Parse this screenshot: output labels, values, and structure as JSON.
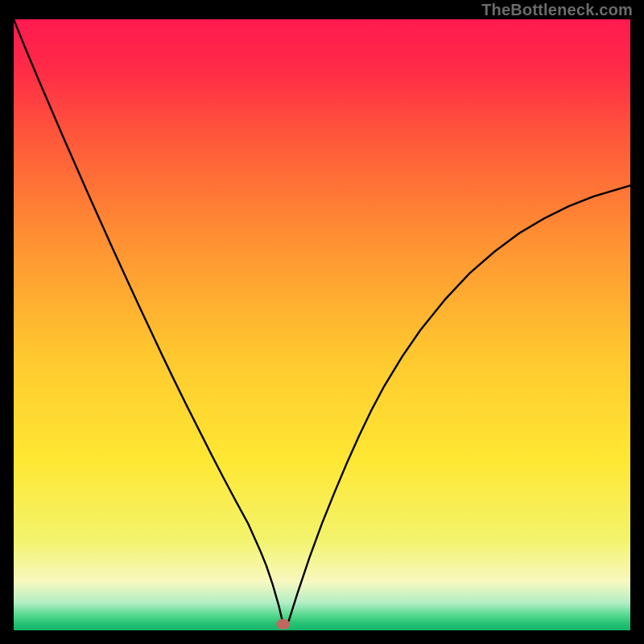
{
  "watermark": "TheBottleneck.com",
  "chart_data": {
    "type": "line",
    "title": "",
    "xlabel": "",
    "ylabel": "",
    "xlim": [
      0,
      100
    ],
    "ylim": [
      0,
      100
    ],
    "background_gradient_stops": [
      {
        "offset": 0.0,
        "color": "#ff1a4f"
      },
      {
        "offset": 0.08,
        "color": "#ff2a47"
      },
      {
        "offset": 0.2,
        "color": "#ff5a3a"
      },
      {
        "offset": 0.35,
        "color": "#ff8d33"
      },
      {
        "offset": 0.55,
        "color": "#ffc82f"
      },
      {
        "offset": 0.72,
        "color": "#ffe733"
      },
      {
        "offset": 0.85,
        "color": "#f3f36b"
      },
      {
        "offset": 0.92,
        "color": "#f8f8c0"
      },
      {
        "offset": 0.955,
        "color": "#b2eec4"
      },
      {
        "offset": 0.975,
        "color": "#57d98f"
      },
      {
        "offset": 0.99,
        "color": "#23c072"
      },
      {
        "offset": 1.0,
        "color": "#17b56a"
      }
    ],
    "series": [
      {
        "name": "bottleneck-curve",
        "color": "#000000",
        "stroke_width": 2.4,
        "x": [
          0.0,
          2.0,
          4.0,
          6.0,
          8.0,
          10.0,
          12.0,
          14.0,
          16.0,
          18.0,
          20.0,
          22.0,
          24.0,
          26.0,
          28.0,
          30.0,
          32.0,
          34.0,
          36.0,
          38.0,
          40.0,
          41.0,
          42.0,
          43.0,
          43.7,
          44.5,
          46.0,
          48.0,
          50.0,
          52.0,
          54.0,
          56.0,
          58.0,
          60.0,
          63.0,
          66.0,
          70.0,
          74.0,
          78.0,
          82.0,
          86.0,
          90.0,
          94.0,
          98.0,
          100.0
        ],
        "y": [
          100.0,
          95.0,
          90.2,
          85.5,
          80.8,
          76.2,
          71.6,
          67.1,
          62.6,
          58.2,
          53.8,
          49.5,
          45.2,
          41.0,
          36.9,
          32.9,
          28.9,
          25.0,
          21.2,
          17.5,
          13.0,
          10.5,
          7.5,
          4.0,
          1.0,
          1.2,
          6.0,
          12.0,
          17.5,
          22.5,
          27.3,
          31.8,
          36.0,
          39.8,
          44.8,
          49.2,
          54.2,
          58.5,
          62.0,
          65.0,
          67.4,
          69.4,
          71.0,
          72.2,
          72.8
        ]
      }
    ],
    "marker": {
      "name": "minimum-marker",
      "x": 43.7,
      "y": 1.0,
      "rx": 1.1,
      "ry": 0.85,
      "color": "#c0685f"
    }
  }
}
